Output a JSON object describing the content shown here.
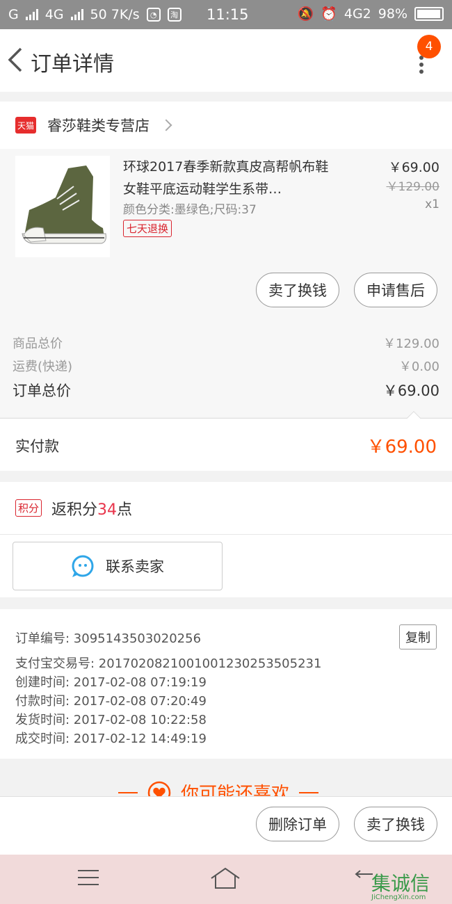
{
  "status_bar": {
    "carrier1": "G",
    "carrier2": "4G",
    "speed": "50 7K/s",
    "app_icon1": "QQ",
    "app_icon2": "淘",
    "time": "11:15",
    "net": "4G2",
    "battery": "98%"
  },
  "nav": {
    "title": "订单详情",
    "badge": "4"
  },
  "shop": {
    "icon_label": "天猫",
    "name": "睿莎鞋类专营店"
  },
  "product": {
    "title": "环球2017春季新款真皮高帮帆布鞋女鞋平底运动鞋学生系带…",
    "sku": "颜色分类:墨绿色;尺码:37",
    "tag": "七天退换",
    "price": "￥69.00",
    "original_price": "￥129.00",
    "qty": "x1",
    "btn_sell": "卖了换钱",
    "btn_aftersale": "申请售后"
  },
  "totals": {
    "goods_label": "商品总价",
    "goods_value": "￥129.00",
    "shipping_label": "运费(快递)",
    "shipping_value": "￥0.00",
    "order_label": "订单总价",
    "order_value": "￥69.00"
  },
  "paid": {
    "label": "实付款",
    "value": "￥69.00"
  },
  "points": {
    "tag": "积分",
    "prefix": "返积分",
    "count": "34",
    "suffix": "点"
  },
  "contact": {
    "label": "联系卖家"
  },
  "order_info": {
    "order_no": "订单编号: 3095143503020256",
    "alipay_no": "支付宝交易号: 2017020821001001230253505231",
    "created": "创建时间: 2017-02-08  07:19:19",
    "paid_time": "付款时间: 2017-02-08  07:20:49",
    "shipped": "发货时间: 2017-02-08  10:22:58",
    "completed": "成交时间: 2017-02-12  14:49:19",
    "copy_btn": "复制"
  },
  "recommend": {
    "label": "你可能还喜欢"
  },
  "bottom": {
    "delete_btn": "删除订单",
    "sell_btn": "卖了换钱"
  },
  "watermark": {
    "text": "集诚信",
    "sub": "JiChengXin.com"
  },
  "colors": {
    "accent": "#ff5000",
    "tmall": "#e62d2d",
    "tag_red": "#d9232d"
  }
}
